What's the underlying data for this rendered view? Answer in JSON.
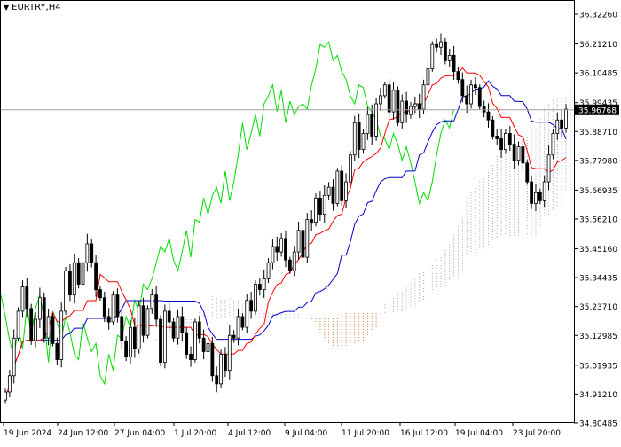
{
  "symbol_label": "EURTRY,H4",
  "chart_data": {
    "type": "candlestick",
    "symbol": "EURTRY",
    "timeframe": "H4",
    "current_price": 35.96768,
    "ylim": [
      34.808,
      36.3226
    ],
    "y_ticks": [
      "36.32260",
      "36.21210",
      "36.10485",
      "35.99435",
      "35.88710",
      "35.77980",
      "35.66935",
      "35.56210",
      "35.45160",
      "35.34435",
      "35.23710",
      "35.12985",
      "35.01935",
      "34.91210",
      "34.80485"
    ],
    "x_ticks": [
      "19 Jun 2024",
      "24 Jun 12:00",
      "27 Jun 04:00",
      "1 Jul 20:00",
      "4 Jul 12:00",
      "9 Jul 04:00",
      "11 Jul 20:00",
      "16 Jul 12:00",
      "19 Jul 04:00",
      "23 Jul 20:00"
    ],
    "indicator": "Ichimoku Kinko Hyo",
    "colors": {
      "bullish": "#ffffff",
      "bearish": "#000000",
      "tenkan": "#ff0000",
      "kijun": "#0000cc",
      "chikou": "#00dd00",
      "cloud": "#e07a3c",
      "cloud_alt": "#a0a0c0",
      "price_line": "#a0a0a0",
      "price_label_bg": "#000000"
    },
    "closes": [
      34.92,
      34.98,
      35.12,
      35.22,
      35.31,
      35.23,
      35.11,
      35.19,
      35.27,
      35.12,
      35.2,
      35.1,
      35.04,
      35.22,
      35.37,
      35.28,
      35.4,
      35.32,
      35.4,
      35.47,
      35.4,
      35.3,
      35.27,
      35.2,
      35.18,
      35.28,
      35.2,
      35.11,
      35.05,
      35.16,
      35.08,
      35.24,
      35.13,
      35.23,
      35.28,
      35.19,
      35.03,
      35.22,
      35.18,
      35.12,
      35.2,
      35.14,
      35.06,
      35.04,
      35.18,
      35.12,
      35.07,
      35.1,
      34.98,
      34.95,
      35.06,
      35.0,
      35.13,
      35.12,
      35.2,
      35.16,
      35.26,
      35.22,
      35.32,
      35.3,
      35.34,
      35.4,
      35.46,
      35.44,
      35.49,
      35.41,
      35.37,
      35.44,
      35.52,
      35.42,
      35.56,
      35.55,
      35.64,
      35.58,
      35.65,
      35.68,
      35.62,
      35.74,
      35.63,
      35.7,
      35.8,
      35.92,
      35.82,
      35.88,
      35.95,
      35.87,
      35.99,
      36.02,
      36.06,
      35.96,
      36.04,
      35.92,
      36.0,
      35.95,
      35.98,
      35.99,
      35.97,
      36.06,
      36.12,
      36.21,
      36.2,
      36.22,
      36.15,
      36.17,
      36.11,
      36.08,
      36.02,
      35.99,
      36.06,
      36.05,
      35.98,
      35.96,
      35.93,
      35.87,
      35.86,
      35.82,
      35.88,
      35.84,
      35.78,
      35.83,
      35.77,
      35.7,
      35.62,
      35.66,
      35.63,
      35.7,
      35.8,
      35.88,
      35.93,
      35.9,
      35.97
    ]
  }
}
